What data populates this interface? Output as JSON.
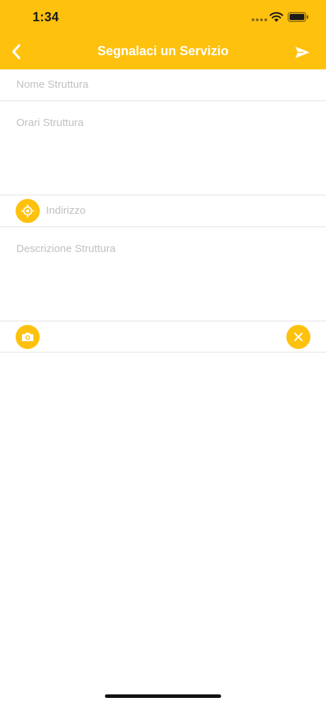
{
  "status_bar": {
    "time": "1:34"
  },
  "nav": {
    "title": "Segnalaci un Servizio",
    "back_icon": "chevron-left-icon",
    "send_icon": "send-icon"
  },
  "form": {
    "nome_placeholder": "Nome Struttura",
    "orari_placeholder": "Orari Struttura",
    "indirizzo_placeholder": "Indirizzo",
    "descrizione_placeholder": "Descrizione Struttura"
  },
  "colors": {
    "accent": "#FEC10E",
    "placeholder": "#C0C0C4",
    "divider": "#E3E3E3"
  }
}
